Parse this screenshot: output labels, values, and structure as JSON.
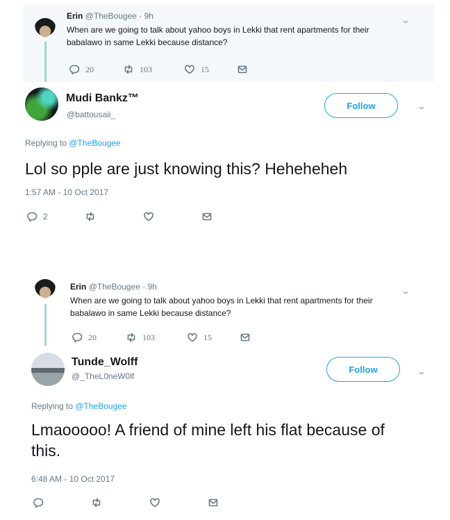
{
  "tweets": [
    {
      "quoted": {
        "name": "Erin",
        "handle_time": "@TheBougee · 9h",
        "text": "When are we going to talk about yahoo boys in Lekki that rent apartments for their babalawo in same Lekki because distance?",
        "replies": "20",
        "retweets": "103",
        "likes": "15"
      },
      "author": {
        "name": "Mudi Bankz™",
        "handle": "@battousaii_"
      },
      "follow_label": "Follow",
      "replying_prefix": "Replying to ",
      "replying_to": "@TheBougee",
      "text": "Lol so pple are just knowing this? Heheheheh",
      "timestamp": "1:57 AM - 10 Oct 2017",
      "replies": "2",
      "icons": [
        "reply-icon",
        "retweet-icon",
        "like-icon",
        "dm-icon",
        "chevron-down-icon"
      ]
    },
    {
      "quoted": {
        "name": "Erin",
        "handle_time": "@TheBougee · 9h",
        "text": "When are we going to talk about yahoo boys in Lekki that rent apartments for their babalawo in same Lekki because distance?",
        "replies": "20",
        "retweets": "103",
        "likes": "15"
      },
      "author": {
        "name": "Tunde_Wolff",
        "handle": "@_TheL0neW0lf"
      },
      "follow_label": "Follow",
      "replying_prefix": "Replying to ",
      "replying_to": "@TheBougee",
      "text": "Lmaooooo! A friend of mine left his flat because of this.",
      "timestamp": "6:48 AM - 10 Oct 2017",
      "replies": "",
      "icons": [
        "reply-icon",
        "retweet-icon",
        "like-icon",
        "dm-icon",
        "chevron-down-icon"
      ]
    }
  ],
  "colors": {
    "accent": "#1da1f2",
    "muted": "#657786",
    "connector": "#9cd9d6",
    "quoted_bg": "#f5f8fa"
  }
}
